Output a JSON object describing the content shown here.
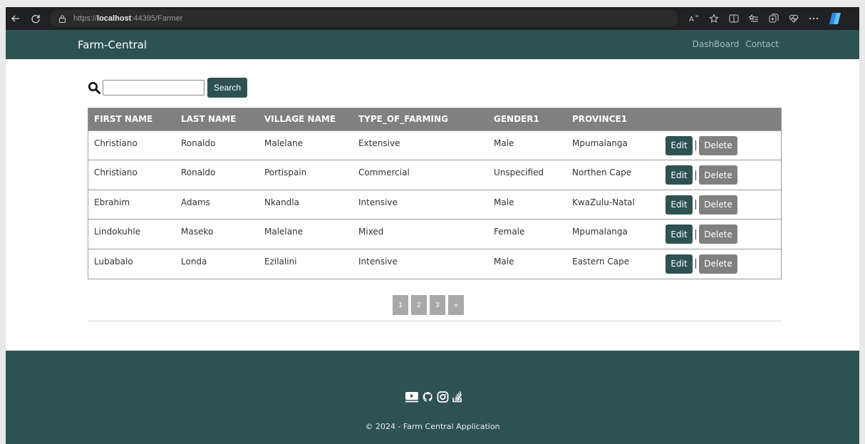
{
  "browser": {
    "url_scheme": "https://",
    "url_host": "localhost",
    "url_rest": ":44395/Farmer",
    "icons": [
      "back-icon",
      "refresh-icon",
      "lock-icon",
      "read-aloud-icon",
      "favorite-icon",
      "split-screen-icon",
      "favorites-list-icon",
      "collections-icon",
      "health-icon",
      "more-icon",
      "copilot-icon"
    ]
  },
  "navbar": {
    "brand": "Farm-Central",
    "links": [
      "DashBoard",
      "Contact"
    ]
  },
  "search": {
    "value": "",
    "button_label": "Search"
  },
  "table": {
    "headers": [
      "FIRST NAME",
      "LAST NAME",
      "VILLAGE NAME",
      "TYPE_OF_FARMING",
      "GENDER1",
      "PROVINCE1"
    ],
    "rows": [
      [
        "Christiano",
        "Ronaldo",
        "Malelane",
        "Extensive",
        "Male",
        "Mpumalanga"
      ],
      [
        "Christiano",
        "Ronaldo",
        "Portispain",
        "Commercial",
        "Unspecified",
        "Northen Cape"
      ],
      [
        "Ebrahim",
        "Adams",
        "Nkandla",
        "Intensive",
        "Male",
        "KwaZulu-Natal"
      ],
      [
        "Lindokuhle",
        "Maseko",
        "Malelane",
        "Mixed",
        "Female",
        "Mpumalanga"
      ],
      [
        "Lubabalo",
        "Londa",
        "Ezilalini",
        "Intensive",
        "Male",
        "Eastern Cape"
      ]
    ],
    "edit_label": "Edit",
    "separator": "|",
    "delete_label": "Delete"
  },
  "pagination": {
    "pages": [
      "1",
      "2",
      "3",
      "»"
    ]
  },
  "footer": {
    "social_icons": [
      "youtube-icon",
      "github-icon",
      "instagram-icon",
      "stackoverflow-icon"
    ],
    "copyright": "© 2024 - Farm Central Application"
  },
  "colors": {
    "primary": "#2e5252",
    "header_gray": "#808080",
    "pager_gray": "#a8a8a8"
  }
}
